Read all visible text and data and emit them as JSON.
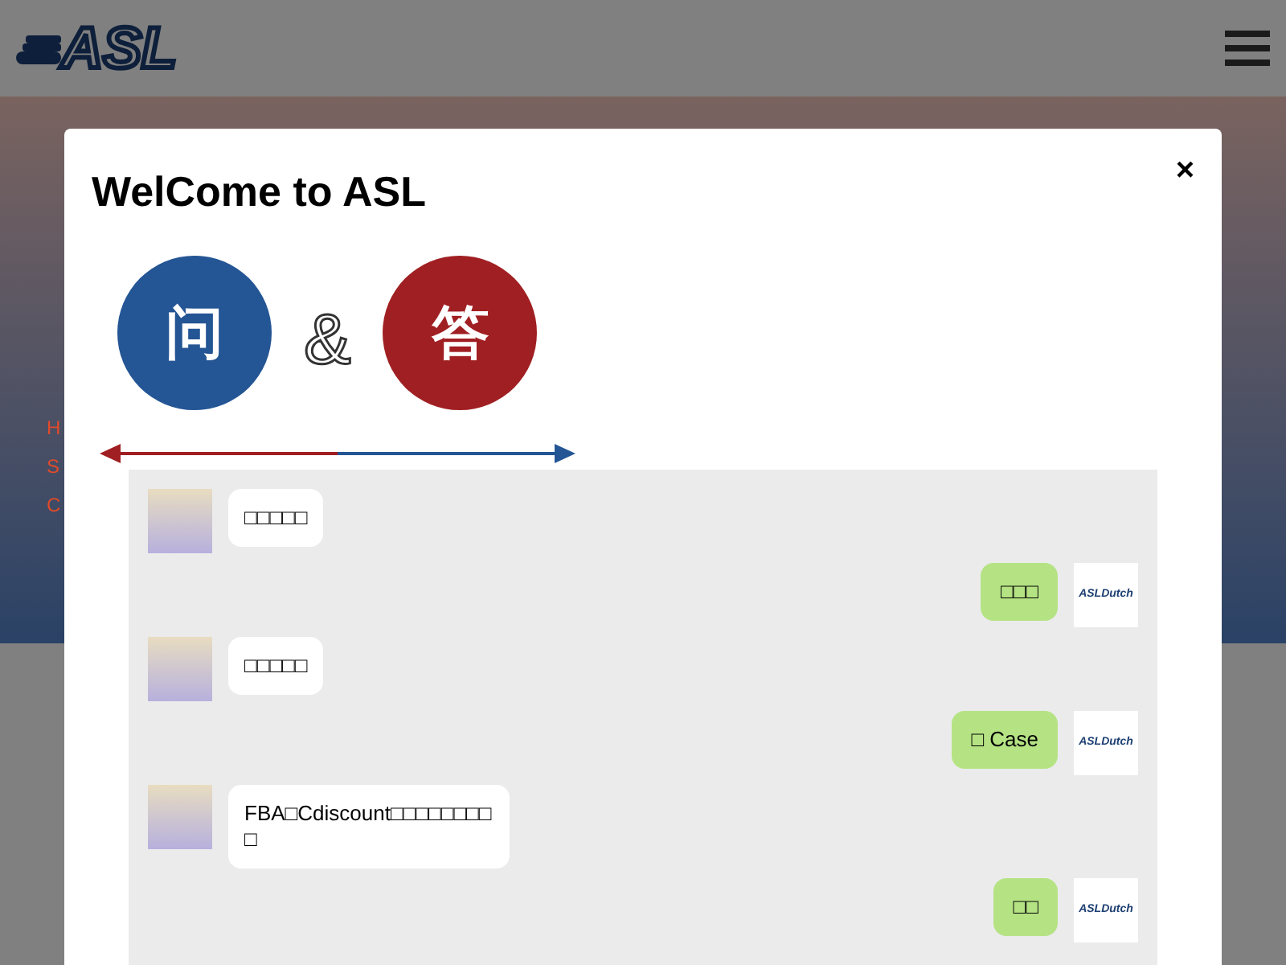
{
  "header": {
    "logo": "ASL"
  },
  "hero": {
    "fragments": [
      "H",
      "S",
      "C"
    ]
  },
  "modal": {
    "title": "WelCome to ASL",
    "close": "×",
    "badges": [
      {
        "label": "问",
        "color": "#245594"
      },
      {
        "label": "答",
        "color": "#a01f22"
      }
    ],
    "connector": "&",
    "messages": [
      {
        "kind": "left",
        "text": "□□□□□"
      },
      {
        "kind": "right",
        "text": "□□□",
        "logo": "ASLDutch"
      },
      {
        "kind": "left",
        "text": "□□□□□"
      },
      {
        "kind": "right",
        "text": "□ Case",
        "logo": "ASLDutch"
      },
      {
        "kind": "left",
        "text": "FBA□Cdiscount□□□□□□□□□"
      },
      {
        "kind": "right",
        "text": "□□",
        "logo": "ASLDutch"
      }
    ]
  }
}
